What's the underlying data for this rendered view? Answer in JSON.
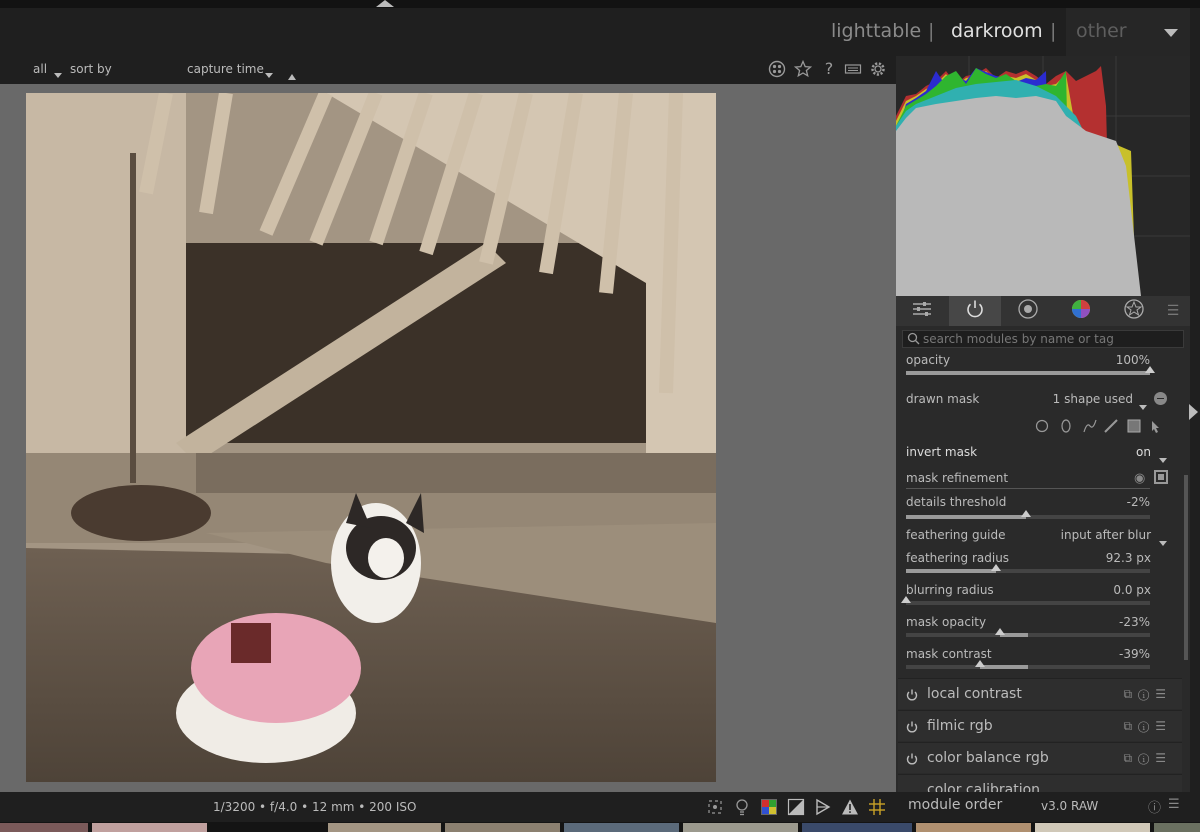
{
  "header": {
    "views": {
      "lighttable": "lighttable",
      "darkroom": "darkroom",
      "other": "other"
    },
    "separator": "|"
  },
  "toolbar": {
    "filter": "all",
    "sort_label": "sort by",
    "sort_value": "capture time"
  },
  "image_info": "1/3200 • f/4.0 • 12 mm • 200 ISO",
  "search": {
    "placeholder": "search modules by name or tag"
  },
  "mask": {
    "opacity_label": "opacity",
    "opacity_value": "100%",
    "opacity_frac": 1.0,
    "drawn_mask_label": "drawn mask",
    "drawn_mask_value": "1 shape used",
    "invert_mask_label": "invert mask",
    "invert_mask_value": "on",
    "mask_refinement_label": "mask refinement",
    "details_threshold_label": "details threshold",
    "details_threshold_value": "-2%",
    "details_threshold_frac": 0.49,
    "feathering_guide_label": "feathering guide",
    "feathering_guide_value": "input after blur",
    "feathering_radius_label": "feathering radius",
    "feathering_radius_value": "92.3 px",
    "feathering_radius_frac": 0.37,
    "blurring_radius_label": "blurring radius",
    "blurring_radius_value": "0.0 px",
    "blurring_radius_frac": 0.0,
    "mask_opacity_label": "mask opacity",
    "mask_opacity_value": "-23%",
    "mask_opacity_frac": 0.385,
    "mask_contrast_label": "mask contrast",
    "mask_contrast_value": "-39%",
    "mask_contrast_frac": 0.305
  },
  "modules": [
    {
      "label": "local contrast"
    },
    {
      "label": "filmic rgb"
    },
    {
      "label": "color balance rgb"
    },
    {
      "label": "color calibration"
    }
  ],
  "footer": {
    "module_order_label": "module order",
    "module_order_value": "v3.0 RAW"
  },
  "icons": {
    "toolbar": [
      "grouping-icon",
      "star-icon",
      "help-icon",
      "keyboard-icon",
      "gear-icon"
    ],
    "tabs": [
      "active-modules-icon",
      "power-icon",
      "base-modules-icon",
      "color-wheel-icon",
      "effects-icon",
      "presets-menu-icon"
    ],
    "shapes": [
      "circle-shape-icon",
      "ellipse-shape-icon",
      "path-shape-icon",
      "brush-shape-icon",
      "gradient-shape-icon",
      "edit-shapes-icon"
    ],
    "bottom": [
      "focus-peaking-icon",
      "color-assessment-icon",
      "softproof-icon",
      "gamut-check-icon",
      "overexposed-icon",
      "raw-overexposed-icon",
      "guides-icon"
    ]
  }
}
